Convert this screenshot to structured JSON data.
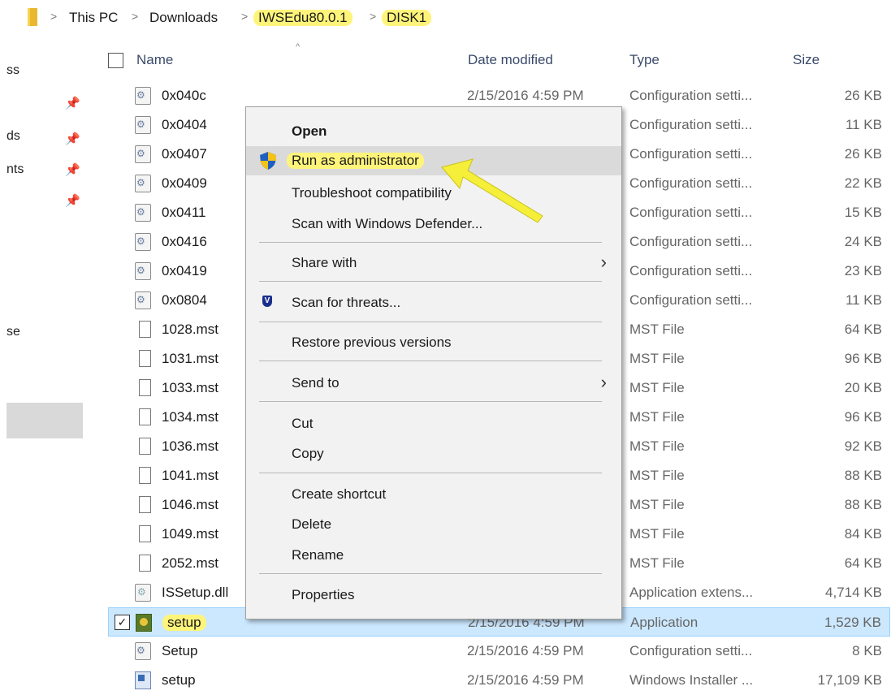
{
  "breadcrumb": {
    "items": [
      "This PC",
      "Downloads",
      "IWSEdu80.0.1",
      "DISK1"
    ]
  },
  "nav": {
    "fragments": [
      "ss",
      "ds",
      "nts",
      "se"
    ]
  },
  "columns": {
    "name": "Name",
    "date": "Date modified",
    "type": "Type",
    "size": "Size"
  },
  "files": [
    {
      "name": "0x040c",
      "date": "2/15/2016 4:59 PM",
      "type": "Configuration setti...",
      "size": "26 KB",
      "icon": "config-file-icon"
    },
    {
      "name": "0x0404",
      "date": "",
      "type": "Configuration setti...",
      "size": "11 KB",
      "icon": "config-file-icon"
    },
    {
      "name": "0x0407",
      "date": "",
      "type": "Configuration setti...",
      "size": "26 KB",
      "icon": "config-file-icon"
    },
    {
      "name": "0x0409",
      "date": "",
      "type": "Configuration setti...",
      "size": "22 KB",
      "icon": "config-file-icon"
    },
    {
      "name": "0x0411",
      "date": "",
      "type": "Configuration setti...",
      "size": "15 KB",
      "icon": "config-file-icon"
    },
    {
      "name": "0x0416",
      "date": "",
      "type": "Configuration setti...",
      "size": "24 KB",
      "icon": "config-file-icon"
    },
    {
      "name": "0x0419",
      "date": "",
      "type": "Configuration setti...",
      "size": "23 KB",
      "icon": "config-file-icon"
    },
    {
      "name": "0x0804",
      "date": "",
      "type": "Configuration setti...",
      "size": "11 KB",
      "icon": "config-file-icon"
    },
    {
      "name": "1028.mst",
      "date": "",
      "type": "MST File",
      "size": "64 KB",
      "icon": "blank-file-icon"
    },
    {
      "name": "1031.mst",
      "date": "",
      "type": "MST File",
      "size": "96 KB",
      "icon": "blank-file-icon"
    },
    {
      "name": "1033.mst",
      "date": "",
      "type": "MST File",
      "size": "20 KB",
      "icon": "blank-file-icon"
    },
    {
      "name": "1034.mst",
      "date": "",
      "type": "MST File",
      "size": "96 KB",
      "icon": "blank-file-icon"
    },
    {
      "name": "1036.mst",
      "date": "",
      "type": "MST File",
      "size": "92 KB",
      "icon": "blank-file-icon"
    },
    {
      "name": "1041.mst",
      "date": "",
      "type": "MST File",
      "size": "88 KB",
      "icon": "blank-file-icon"
    },
    {
      "name": "1046.mst",
      "date": "",
      "type": "MST File",
      "size": "88 KB",
      "icon": "blank-file-icon"
    },
    {
      "name": "1049.mst",
      "date": "",
      "type": "MST File",
      "size": "84 KB",
      "icon": "blank-file-icon"
    },
    {
      "name": "2052.mst",
      "date": "",
      "type": "MST File",
      "size": "64 KB",
      "icon": "blank-file-icon"
    },
    {
      "name": "ISSetup.dll",
      "date": "",
      "type": "Application extens...",
      "size": "4,714 KB",
      "icon": "dll-file-icon"
    },
    {
      "name": "setup",
      "date": "2/15/2016 4:59 PM",
      "type": "Application",
      "size": "1,529 KB",
      "icon": "application-icon",
      "selected": true
    },
    {
      "name": "Setup",
      "date": "2/15/2016 4:59 PM",
      "type": "Configuration setti...",
      "size": "8 KB",
      "icon": "config-file-icon"
    },
    {
      "name": "setup",
      "date": "2/15/2016 4:59 PM",
      "type": "Windows Installer ...",
      "size": "17,109 KB",
      "icon": "installer-icon"
    }
  ],
  "context_menu": {
    "open": "Open",
    "run_as_admin": "Run as administrator",
    "troubleshoot": "Troubleshoot compatibility",
    "scan_defender": "Scan with Windows Defender...",
    "share_with": "Share with",
    "scan_threats": "Scan for threats...",
    "restore": "Restore previous versions",
    "send_to": "Send to",
    "cut": "Cut",
    "copy": "Copy",
    "create_shortcut": "Create shortcut",
    "delete": "Delete",
    "rename": "Rename",
    "properties": "Properties"
  },
  "colors": {
    "highlight": "#fff47a",
    "selection": "#cce8ff",
    "arrow": "#f5ef3a"
  }
}
